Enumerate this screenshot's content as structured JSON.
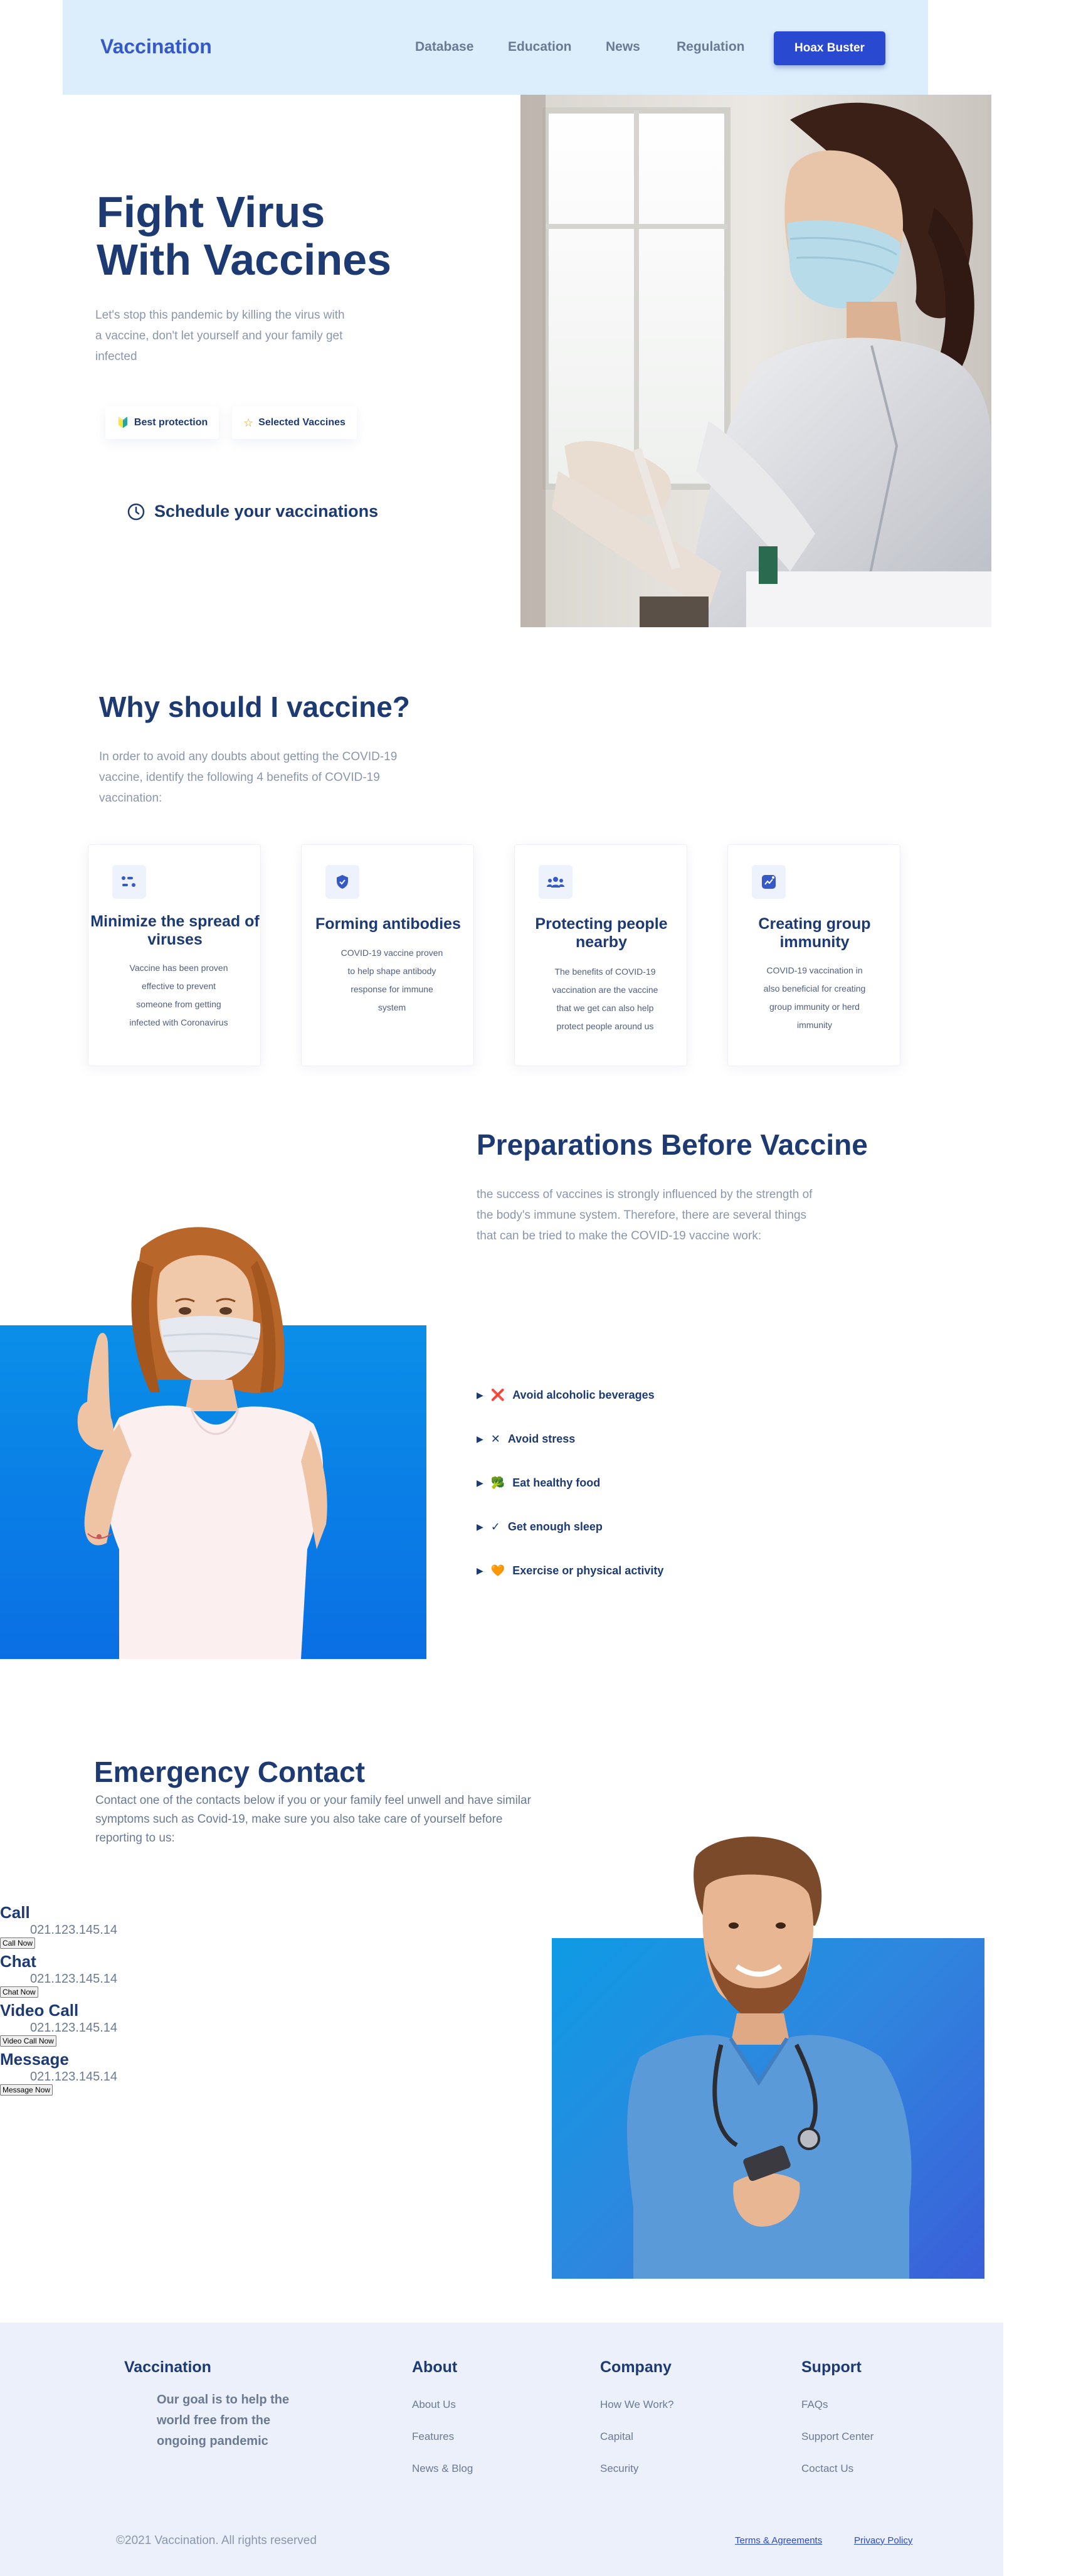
{
  "header": {
    "brand": "Vaccination",
    "nav": [
      "Database",
      "Education",
      "News",
      "Regulation"
    ],
    "cta": "Hoax Buster"
  },
  "hero": {
    "title_line1": "Fight Virus",
    "title_line2": "With Vaccines",
    "description": "Let's stop this pandemic by killing the virus with a vaccine, don't let yourself and your family get infected",
    "badges": [
      "Best protection",
      "Selected Vaccines"
    ],
    "schedule": "Schedule your vaccinations"
  },
  "why": {
    "title": "Why should I vaccine?",
    "description": "In order to avoid any doubts about getting the COVID-19 vaccine, identify the following 4 benefits of COVID-19 vaccination:",
    "cards": [
      {
        "title": "Minimize the spread of viruses",
        "text": "Vaccine has been proven effective to prevent someone from getting infected with Coronavirus",
        "icon": "list-icon"
      },
      {
        "title": "Forming antibodies",
        "text": "COVID-19 vaccine proven to help shape antibody response for immune system",
        "icon": "shield-icon"
      },
      {
        "title": "Protecting people nearby",
        "text": "The benefits of COVID-19 vaccination are the vaccine that we get can also help protect people around us",
        "icon": "people-icon"
      },
      {
        "title": "Creating group immunity",
        "text": "COVID-19 vaccination in also beneficial for creating group immunity or herd immunity",
        "icon": "trend-icon"
      }
    ]
  },
  "preparations": {
    "title": "Preparations Before Vaccine",
    "description": "the success of vaccines is strongly influenced by the strength of the body's immune system. Therefore, there are several things that can be tried to make the COVID-19 vaccine work:",
    "items": [
      {
        "emoji": "❌",
        "label": "Avoid alcoholic beverages"
      },
      {
        "emoji": "✕",
        "label": "Avoid stress"
      },
      {
        "emoji": "🥦",
        "label": "Eat healthy food"
      },
      {
        "emoji": "✓",
        "label": "Get enough sleep"
      },
      {
        "emoji": "🧡",
        "label": "Exercise or physical activity"
      }
    ]
  },
  "emergency": {
    "title": "Emergency Contact",
    "description": "Contact one of the contacts below if you or your family feel unwell and have similar symptoms such as Covid-19, make sure you also take care of yourself before reporting to us:",
    "contacts": [
      {
        "label": "Call",
        "number": "021.123.145.14",
        "button": "Call Now"
      },
      {
        "label": "Chat",
        "number": "021.123.145.14",
        "button": "Chat Now"
      },
      {
        "label": "Video Call",
        "number": "021.123.145.14",
        "button": "Video Call Now"
      },
      {
        "label": "Message",
        "number": "021.123.145.14",
        "button": "Message Now"
      }
    ]
  },
  "footer": {
    "brand": "Vaccination",
    "goal": "Our goal is to help the world free from the ongoing pandemic",
    "columns": [
      {
        "title": "About",
        "links": [
          "About Us",
          "Features",
          "News & Blog"
        ]
      },
      {
        "title": "Company",
        "links": [
          "How We Work?",
          "Capital",
          "Security"
        ]
      },
      {
        "title": "Support",
        "links": [
          "FAQs",
          "Support Center",
          "Coctact Us"
        ]
      }
    ],
    "copyright": "©2021 Vaccination. All rights reserved",
    "legal": [
      "Terms & Agreements",
      "Privacy Policy"
    ]
  },
  "colors": {
    "primary": "#1d3a72",
    "accent": "#2a49d1",
    "header_bg": "#dcedfb",
    "footer_bg": "#ebf0fb"
  }
}
